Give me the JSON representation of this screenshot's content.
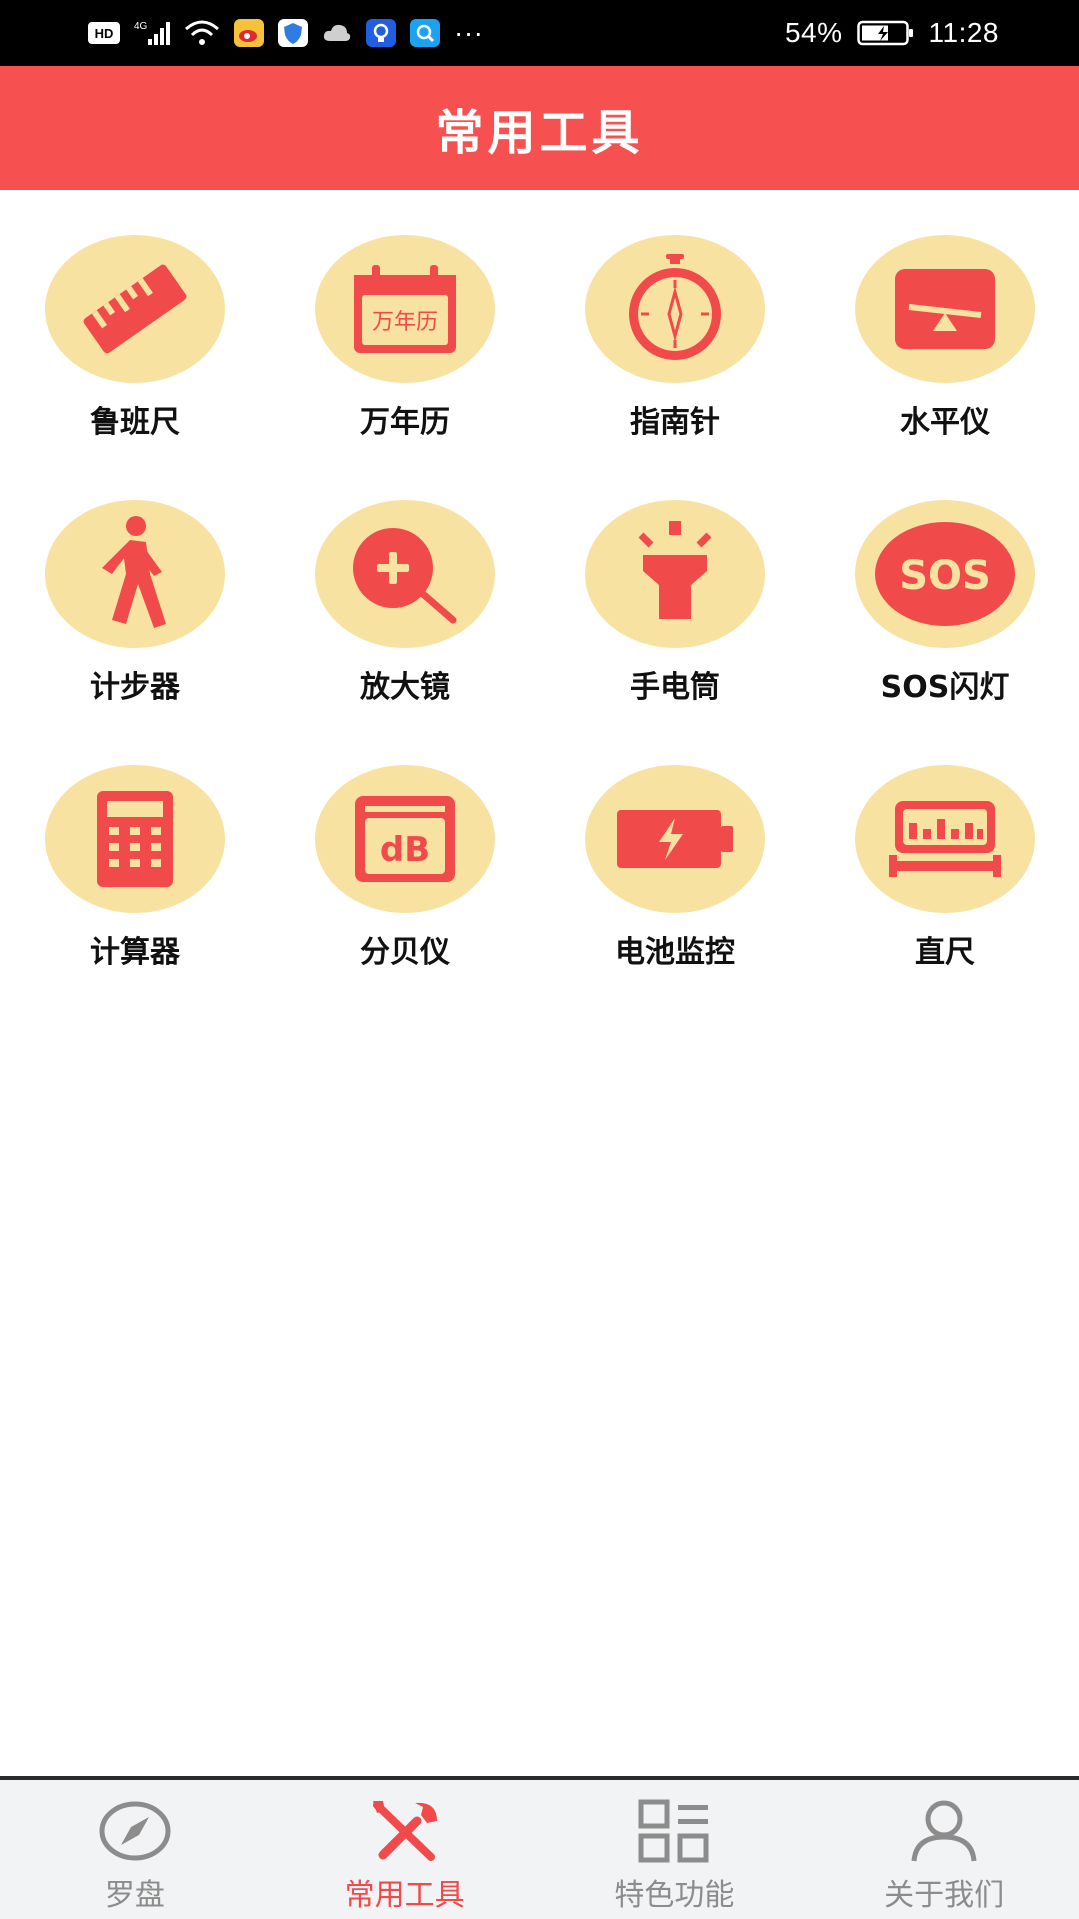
{
  "status_bar": {
    "battery": "54%",
    "time": "11:28",
    "hd_badge": "HD",
    "signal_label": "4G",
    "overflow": "···",
    "icons": [
      "hd-icon",
      "cell-signal-icon",
      "wifi-icon",
      "weibo-icon",
      "shield-icon",
      "cloud-icon",
      "lightbulb-icon",
      "search-app-icon",
      "battery-charging-icon"
    ]
  },
  "header": {
    "title": "常用工具"
  },
  "tools": [
    {
      "label": "鲁班尺",
      "icon": "ruler-diagonal-icon"
    },
    {
      "label": "万年历",
      "icon": "calendar-icon",
      "icon_text": "万年历"
    },
    {
      "label": "指南针",
      "icon": "compass-icon"
    },
    {
      "label": "水平仪",
      "icon": "level-seesaw-icon"
    },
    {
      "label": "计步器",
      "icon": "walking-person-icon"
    },
    {
      "label": "放大镜",
      "icon": "magnifier-icon"
    },
    {
      "label": "手电筒",
      "icon": "flashlight-icon"
    },
    {
      "label": "SOS闪灯",
      "icon": "sos-icon",
      "icon_text": "SOS"
    },
    {
      "label": "计算器",
      "icon": "calculator-icon"
    },
    {
      "label": "分贝仪",
      "icon": "decibel-meter-icon",
      "icon_text": "dB"
    },
    {
      "label": "电池监控",
      "icon": "battery-icon"
    },
    {
      "label": "直尺",
      "icon": "ruler-icon"
    }
  ],
  "nav": [
    {
      "label": "罗盘",
      "icon": "compass-nav-icon",
      "active": false
    },
    {
      "label": "常用工具",
      "icon": "tools-nav-icon",
      "active": true
    },
    {
      "label": "特色功能",
      "icon": "grid-nav-icon",
      "active": false
    },
    {
      "label": "关于我们",
      "icon": "user-nav-icon",
      "active": false
    }
  ],
  "colors": {
    "accent": "#f75050",
    "icon_red": "#f04a4a",
    "circle_bg": "#f7e2a2",
    "nav_inactive": "#8c8c8c"
  }
}
